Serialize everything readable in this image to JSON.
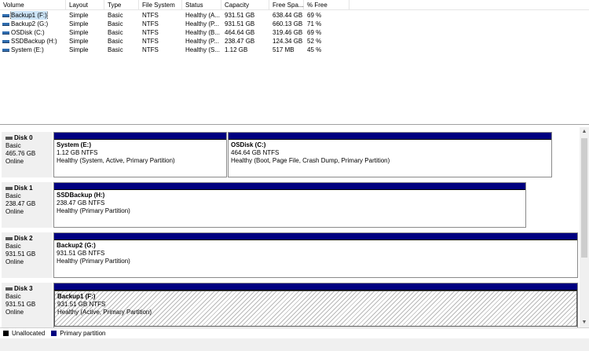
{
  "columns": [
    "Volume",
    "Layout",
    "Type",
    "File System",
    "Status",
    "Capacity",
    "Free Spa...",
    "% Free"
  ],
  "volumes": [
    [
      "Backup1 (F:)",
      "Simple",
      "Basic",
      "NTFS",
      "Healthy (A...",
      "931.51 GB",
      "638.44 GB",
      "69 %"
    ],
    [
      "Backup2 (G:)",
      "Simple",
      "Basic",
      "NTFS",
      "Healthy (P...",
      "931.51 GB",
      "660.13 GB",
      "71 %"
    ],
    [
      "OSDisk (C:)",
      "Simple",
      "Basic",
      "NTFS",
      "Healthy (B...",
      "464.64 GB",
      "319.46 GB",
      "69 %"
    ],
    [
      "SSDBackup (H:)",
      "Simple",
      "Basic",
      "NTFS",
      "Healthy (P...",
      "238.47 GB",
      "124.34 GB",
      "52 %"
    ],
    [
      "System (E:)",
      "Simple",
      "Basic",
      "NTFS",
      "Healthy (S...",
      "1.12 GB",
      "517 MB",
      "45 %"
    ]
  ],
  "disks": [
    {
      "name": "Disk 0",
      "type": "Basic",
      "size": "465.76 GB",
      "status": "Online",
      "partitions": [
        {
          "title": "System  (E:)",
          "size": "1.12 GB NTFS",
          "status": "Healthy (System, Active, Primary Partition)"
        },
        {
          "title": "OSDisk  (C:)",
          "size": "464.64 GB NTFS",
          "status": "Healthy (Boot, Page File, Crash Dump, Primary Partition)"
        }
      ]
    },
    {
      "name": "Disk 1",
      "type": "Basic",
      "size": "238.47 GB",
      "status": "Online",
      "partitions": [
        {
          "title": "SSDBackup  (H:)",
          "size": "238.47 GB NTFS",
          "status": "Healthy (Primary Partition)"
        }
      ]
    },
    {
      "name": "Disk 2",
      "type": "Basic",
      "size": "931.51 GB",
      "status": "Online",
      "partitions": [
        {
          "title": "Backup2  (G:)",
          "size": "931.51 GB NTFS",
          "status": "Healthy (Primary Partition)"
        }
      ]
    },
    {
      "name": "Disk 3",
      "type": "Basic",
      "size": "931.51 GB",
      "status": "Online",
      "partitions": [
        {
          "title": "Backup1  (F:)",
          "size": "931.51 GB NTFS",
          "status": "Healthy (Active, Primary Partition)"
        }
      ]
    }
  ],
  "legend": {
    "unallocated": "Unallocated",
    "primary": "Primary partition"
  },
  "colors": {
    "primary_partition": "#000080",
    "unallocated": "#000000",
    "volume_icon": "#2f6db0"
  },
  "icons": {
    "volume": "volume-icon",
    "disk": "disk-icon",
    "scroll_up": "scroll-up-icon",
    "scroll_down": "scroll-down-icon"
  }
}
